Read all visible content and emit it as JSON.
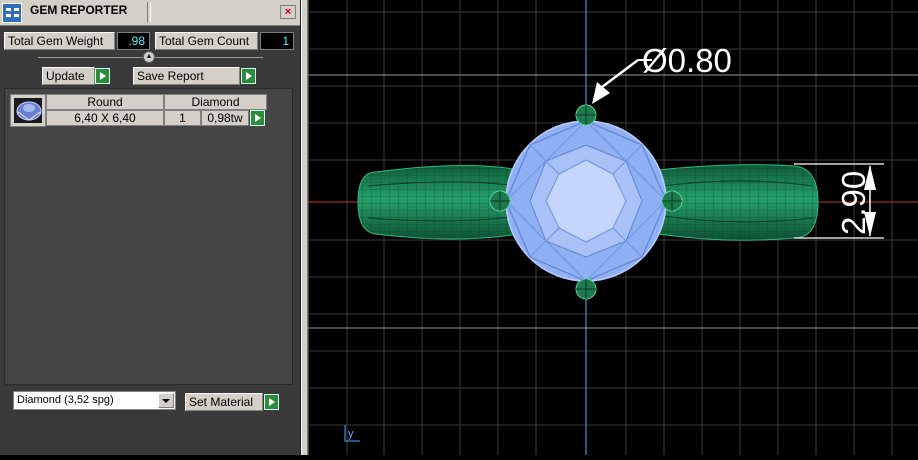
{
  "panel": {
    "title": "GEM REPORTER",
    "close_glyph": "×",
    "total_weight_label": "Total Gem Weight",
    "total_weight_value": ".98",
    "total_count_label": "Total Gem Count",
    "total_count_value": "1",
    "update_label": "Update",
    "save_report_label": "Save Report",
    "gem_row": {
      "shape": "Round",
      "material": "Diamond",
      "size": "6,40 X 6,40",
      "count": "1",
      "weight": "0,98tw"
    },
    "material_select": {
      "value": "Diamond     (3,52 spg)"
    },
    "set_material_label": "Set Material"
  },
  "viewport": {
    "diameter_dim": "Ø0.80",
    "height_dim": "2.90",
    "axis_label": "y",
    "colors": {
      "ring": "#1c7a4d",
      "stone": "#8fb0f2",
      "grid": "#3a3a3a",
      "dim": "#ffffff"
    }
  }
}
